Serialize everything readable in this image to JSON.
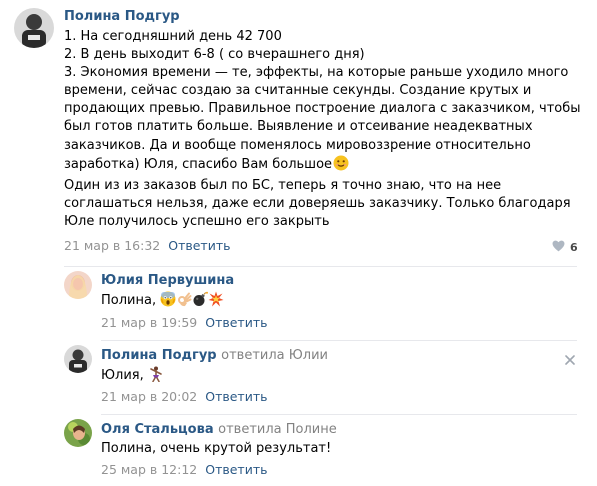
{
  "main": {
    "author": "Полина Подгур",
    "lines": [
      "1. На сегодняшний день 42 700",
      "2. В день выходит 6-8 ( со вчерашнего дня)",
      "3. Экономия времени — те, эффекты, на которые раньше уходило много",
      "времени, сейчас создаю за считанные секунды. Создание крутых и",
      "продающих превью. Правильное построение диалога с заказчиком, чтобы",
      "был готов платить больше. Выявление и отсеивание неадекватных",
      "заказчиков. Да и вообще поменялось мировоззрение относительно",
      "заработка) Юля, спасибо Вам большое",
      "Один из из заказов был по БС, теперь я точно знаю, что на нее",
      "соглашаться нельзя, даже если доверяешь заказчику. Только благодаря",
      "Юле получилось успешно его закрыть"
    ],
    "date": "21 мар в 16:32",
    "reply_label": "Ответить",
    "likes": "6"
  },
  "replies": [
    {
      "author": "Юлия Первушина",
      "replied_to": "",
      "text": "Полина,",
      "date": "21 мар в 19:59",
      "reply_label": "Ответить"
    },
    {
      "author": "Полина Подгур",
      "replied_to": "ответила Юлии",
      "text": "Юлия,",
      "date": "21 мар в 20:02",
      "reply_label": "Ответить"
    },
    {
      "author": "Оля Стальцова",
      "replied_to": "ответила Полине",
      "text": "Полина, очень крутой результат!",
      "date": "25 мар в 12:12",
      "reply_label": "Ответить"
    }
  ],
  "icons": {
    "like": "heart-icon",
    "delete": "close-icon",
    "emojis": [
      "smiling-face-emoji",
      "scream-emoji",
      "ok-hand-emoji",
      "bomb-emoji",
      "collision-emoji",
      "dancer-emoji"
    ]
  },
  "colors": {
    "link": "#2a5885",
    "meta": "#939393",
    "divider": "#e7e8ec"
  }
}
